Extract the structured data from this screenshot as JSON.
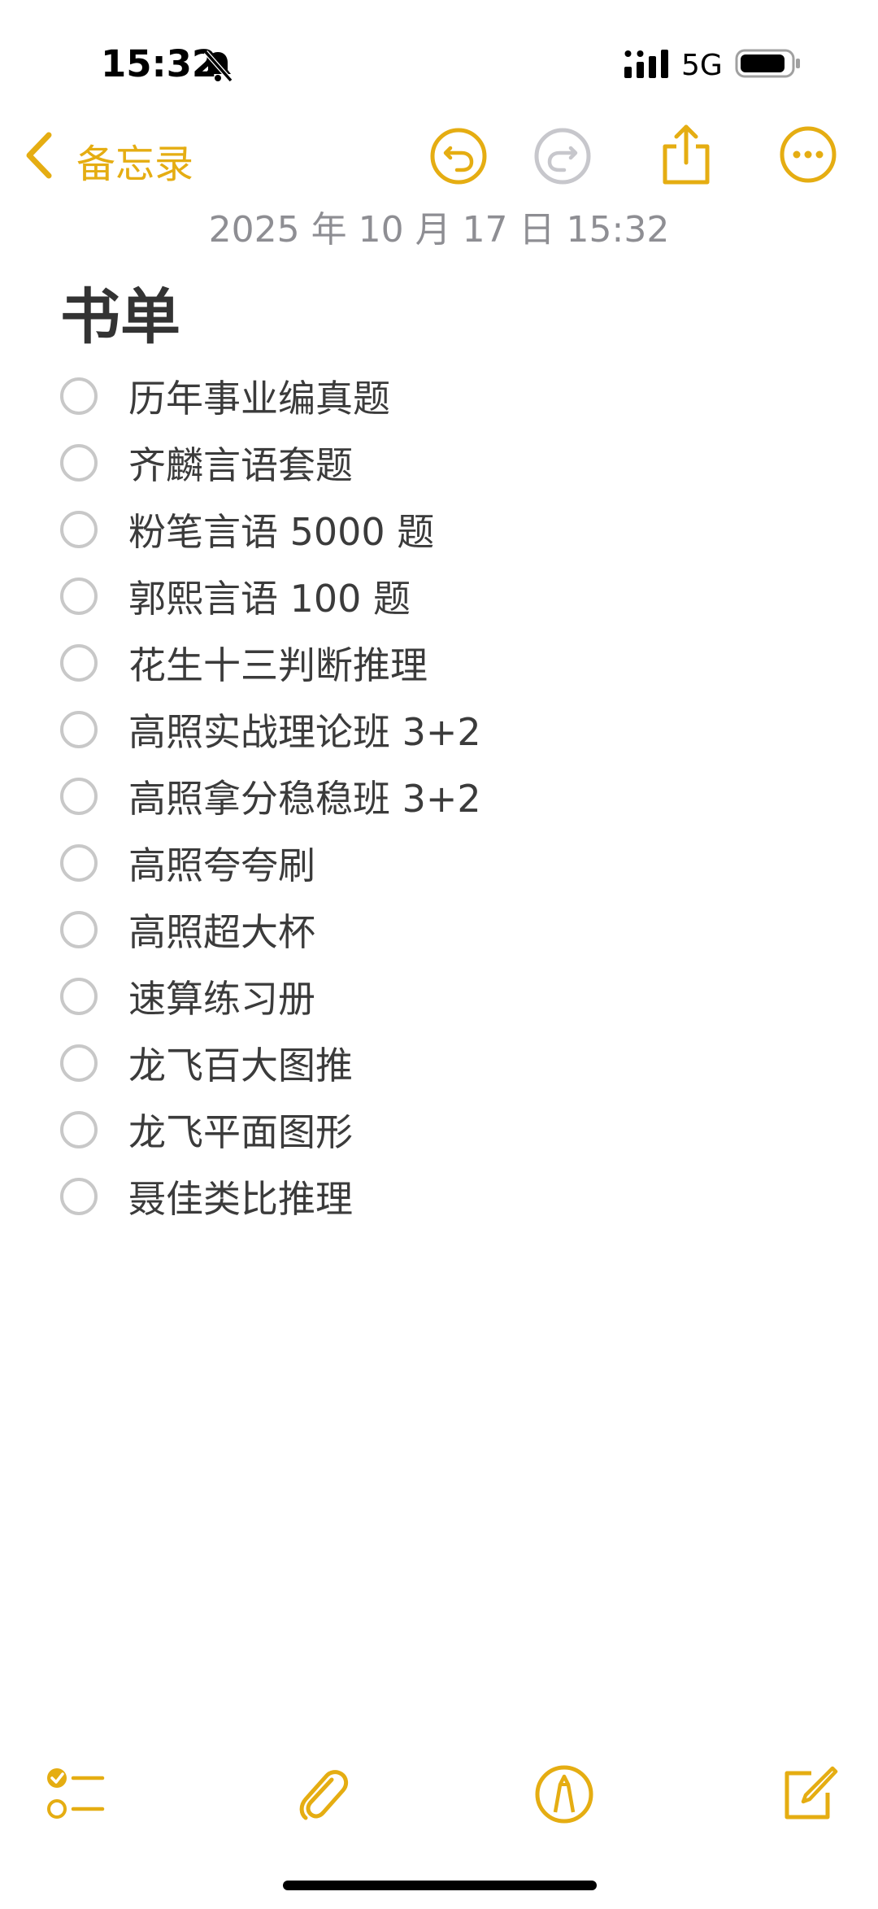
{
  "status_bar": {
    "time": "15:32",
    "network": "5G",
    "icons": [
      "bell-slash-icon",
      "signal-icon",
      "battery-icon"
    ]
  },
  "nav": {
    "back_label": "备忘录",
    "icons": [
      "chevron-left-icon",
      "undo-icon",
      "redo-icon",
      "share-icon",
      "more-icon"
    ]
  },
  "note": {
    "timestamp": "2025 年 10 月 17 日 15:32",
    "title": "书单",
    "checklist": [
      "历年事业编真题",
      "齐麟言语套题",
      "粉笔言语 5000 题",
      "郭熙言语 100 题",
      "花生十三判断推理",
      "高照实战理论班 3+2",
      "高照拿分稳稳班 3+2",
      "高照夸夸刷",
      "高照超大杯",
      "速算练习册",
      "龙飞百大图推",
      "龙飞平面图形",
      "聂佳类比推理"
    ]
  },
  "toolbar": {
    "icons": [
      "checklist-icon",
      "paperclip-icon",
      "markup-icon",
      "compose-icon"
    ]
  },
  "colors": {
    "accent": "#e5ad12",
    "text": "#3b3b3b",
    "timestamp": "#8e8e93",
    "disabled": "#c7c7cc",
    "checkbox": "#c8c8c8"
  }
}
